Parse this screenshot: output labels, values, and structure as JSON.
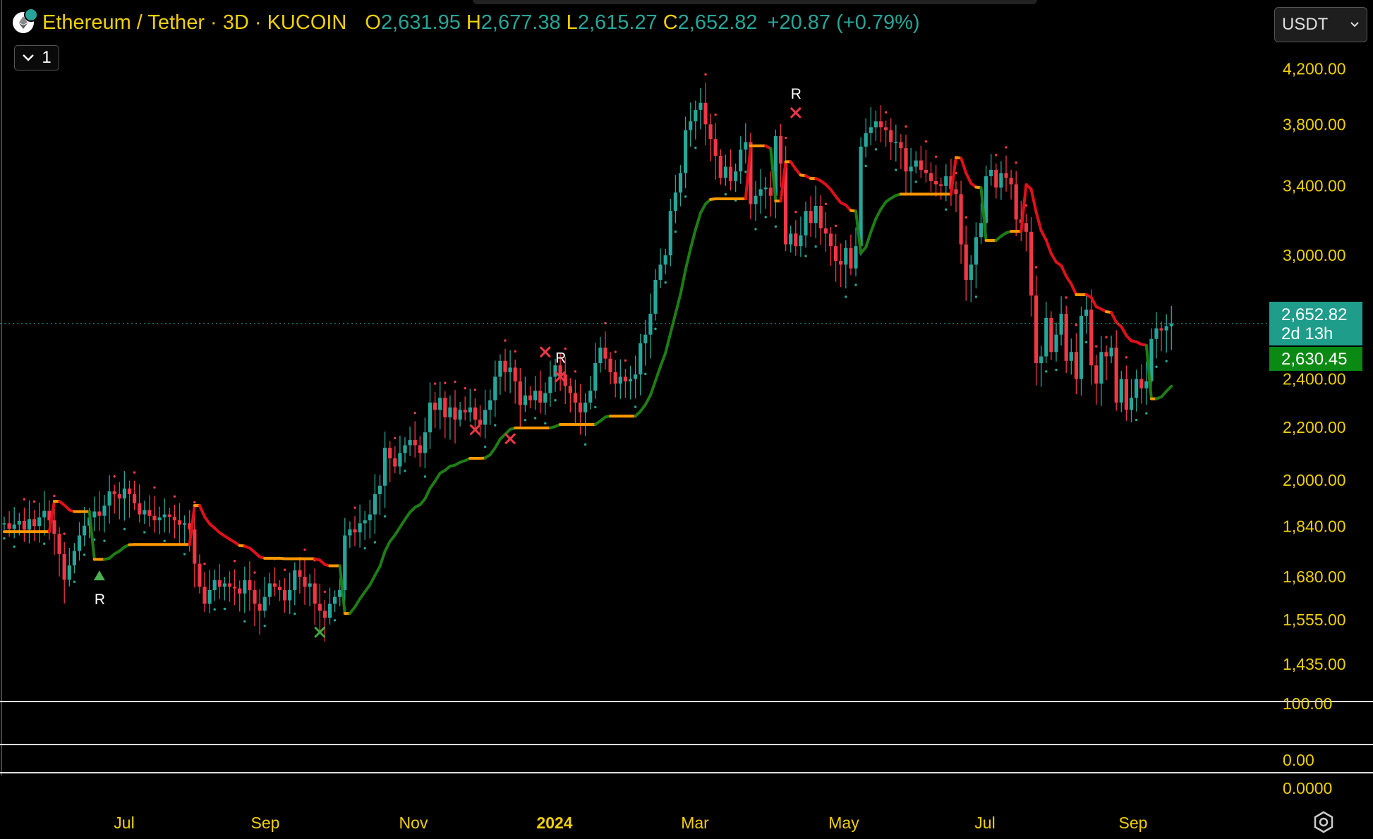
{
  "header": {
    "symbol": "Ethereum / Tether · 3D · KUCOIN",
    "open_label": "O",
    "open": "2,631.95",
    "high_label": "H",
    "high": "2,677.38",
    "low_label": "L",
    "low": "2,615.27",
    "close_label": "C",
    "close": "2,652.82",
    "change": "+20.87 (+0.79%)"
  },
  "legend_toggle": {
    "icon": "chevron-down-icon",
    "count": "1"
  },
  "currency_selector": {
    "value": "USDT",
    "icon": "chevron-down-icon"
  },
  "settings": {
    "icon": "settings-icon"
  },
  "colors": {
    "up": "#26a69a",
    "down": "#f23645",
    "label": "#f0d000",
    "trend_up": "#1e7d14",
    "trend_down": "#e0101a",
    "trend_flat": "#ff9800"
  },
  "chart_data": {
    "type": "candlestick",
    "timeframe": "3D",
    "y_scale": "log",
    "y_range": [
      1350,
      4350
    ],
    "y_ticks": [
      "4,200.00",
      "3,800.00",
      "3,400.00",
      "3,000.00",
      "2,400.00",
      "2,200.00",
      "2,000.00",
      "1,840.00",
      "1,680.00",
      "1,555.00",
      "1,435.00"
    ],
    "x_ticks": [
      "Jul",
      "Sep",
      "Nov",
      "2024",
      "Mar",
      "May",
      "Jul",
      "Sep"
    ],
    "price_line": {
      "value": "2,652.82",
      "countdown": "2d 13h"
    },
    "trail_label": "2,630.45",
    "pane_ticks": [
      "100.00",
      "0.00",
      "0.0000"
    ],
    "closes": [
      1850,
      1832,
      1846,
      1858,
      1829,
      1864,
      1841,
      1870,
      1892,
      1860,
      1815,
      1750,
      1671,
      1715,
      1760,
      1810,
      1842,
      1870,
      1890,
      1875,
      1910,
      1960,
      1950,
      1935,
      1970,
      1950,
      1918,
      1880,
      1895,
      1875,
      1860,
      1870,
      1880,
      1872,
      1860,
      1845,
      1850,
      1830,
      1720,
      1650,
      1600,
      1640,
      1670,
      1650,
      1660,
      1650,
      1645,
      1630,
      1670,
      1640,
      1600,
      1580,
      1620,
      1660,
      1650,
      1640,
      1610,
      1640,
      1700,
      1680,
      1650,
      1660,
      1600,
      1580,
      1560,
      1600,
      1620,
      1640,
      1810,
      1830,
      1820,
      1850,
      1860,
      1880,
      1950,
      1980,
      2120,
      2080,
      2050,
      2100,
      2130,
      2150,
      2130,
      2100,
      2180,
      2300,
      2270,
      2320,
      2240,
      2280,
      2230,
      2270,
      2260,
      2280,
      2230,
      2210,
      2270,
      2310,
      2410,
      2480,
      2430,
      2450,
      2390,
      2290,
      2330,
      2310,
      2350,
      2300,
      2340,
      2410,
      2460,
      2420,
      2370,
      2340,
      2300,
      2260,
      2300,
      2350,
      2470,
      2540,
      2490,
      2430,
      2380,
      2410,
      2390,
      2400,
      2420,
      2560,
      2600,
      2700,
      2870,
      2950,
      3000,
      3250,
      3360,
      3480,
      3760,
      3820,
      3900,
      3950,
      3800,
      3700,
      3590,
      3450,
      3520,
      3430,
      3490,
      3630,
      3680,
      3290,
      3340,
      3380,
      3390,
      3340,
      3720,
      3540,
      3060,
      3120,
      3050,
      3110,
      3250,
      3180,
      3280,
      3150,
      3120,
      3050,
      2970,
      2950,
      3040,
      2930,
      3050,
      3650,
      3740,
      3780,
      3820,
      3780,
      3760,
      3680,
      3680,
      3640,
      3490,
      3520,
      3560,
      3500,
      3480,
      3430,
      3410,
      3400,
      3460,
      3380,
      3350,
      3060,
      2870,
      2950,
      3100,
      3180,
      3460,
      3500,
      3390,
      3480,
      3450,
      3410,
      3200,
      3180,
      3130,
      2790,
      2470,
      2500,
      2680,
      2520,
      2600,
      2700,
      2480,
      2520,
      2400,
      2690,
      2720,
      2460,
      2380,
      2520,
      2500,
      2540,
      2300,
      2400,
      2270,
      2320,
      2400,
      2360,
      2390,
      2580,
      2630,
      2620,
      2640,
      2653
    ],
    "markers": [
      {
        "type": "triangle-up",
        "bar": 19,
        "price": 1682,
        "label": "R"
      },
      {
        "type": "cross-green",
        "bar": 63,
        "price": 1520
      },
      {
        "type": "cross-red",
        "bar": 94,
        "price": 2190
      },
      {
        "type": "cross-red",
        "bar": 101,
        "price": 2155
      },
      {
        "type": "cross-red",
        "bar": 108,
        "price": 2520
      },
      {
        "type": "cross-red",
        "bar": 111,
        "price": 2410,
        "label": "R"
      },
      {
        "type": "cross-red",
        "bar": 158,
        "price": 3880,
        "label": "R"
      }
    ]
  }
}
